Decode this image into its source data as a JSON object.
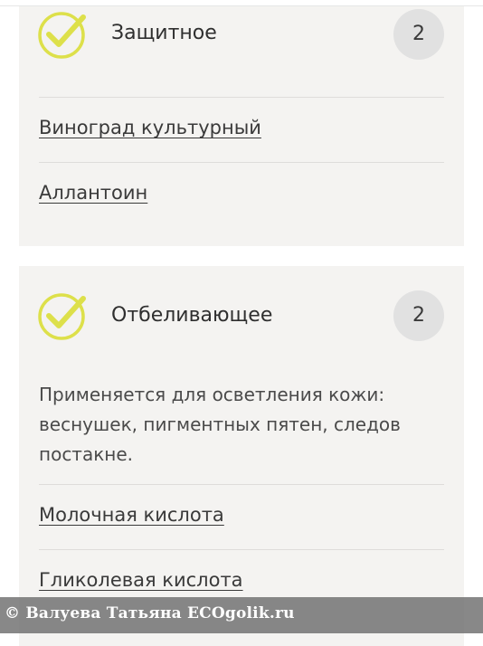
{
  "sections": [
    {
      "title": "Защитное",
      "count": "2",
      "ingredients": [
        "Виноград культурный",
        "Аллантоин"
      ]
    },
    {
      "title": "Отбеливающее",
      "count": "2",
      "description": "Применяется для осветления кожи: веснушек, пигментных пятен, следов постакне.",
      "ingredients": [
        "Молочная кислота",
        "Гликолевая кислота"
      ]
    }
  ],
  "watermark": "© Валуева Татьяна ECOgolik.ru",
  "icons": {
    "section": "check-circle-icon"
  },
  "colors": {
    "card_background": "#f4f3f1",
    "check_accent": "#dde04a",
    "badge_background": "#e1e1e1",
    "text": "#333333"
  }
}
